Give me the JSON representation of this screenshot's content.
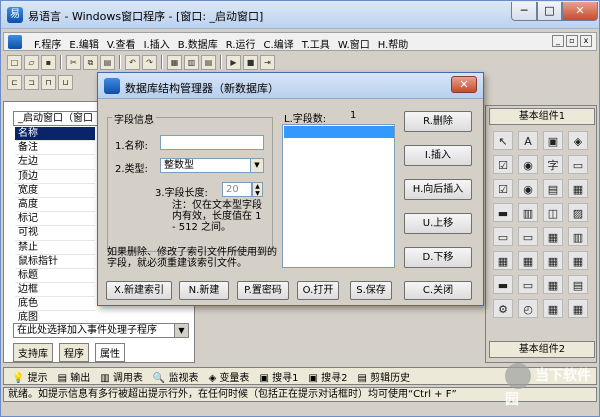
{
  "window": {
    "title": "易语言 - Windows窗口程序 - [窗口: _启动窗口]",
    "min": "─",
    "max": "□",
    "close": "✕"
  },
  "menu": [
    "F.程序",
    "E.编辑",
    "V.查看",
    "I.插入",
    "B.数据库",
    "R.运行",
    "C.编译",
    "T.工具",
    "W.窗口",
    "H.帮助"
  ],
  "left_panel": {
    "header": "_启动窗口（窗口",
    "properties": [
      "名称",
      "备注",
      "左边",
      "顶边",
      "宽度",
      "高度",
      "标记",
      "可视",
      "禁止",
      "鼠标指针",
      "标题",
      "边框",
      "底色",
      "底图"
    ],
    "event_select": "在此处选择加入事件处理子程序",
    "tabs": [
      "支持库",
      "程序",
      "属性"
    ]
  },
  "right_panel": {
    "header": "基本组件1",
    "footer": "基本组件2",
    "components": [
      "↖",
      "A",
      "▣",
      "◈",
      "☑",
      "◉",
      "字",
      "▭",
      "☑",
      "◉",
      "▤",
      "▦",
      "▬",
      "▥",
      "◫",
      "▨",
      "▭",
      "▭",
      "▦",
      "▥",
      "▦",
      "▦",
      "▦",
      "▦",
      "▬",
      "▭",
      "▦",
      "▤",
      "⚙",
      "◴",
      "▦",
      "▦"
    ]
  },
  "output_tabs": [
    "提示",
    "输出",
    "调用表",
    "监视表",
    "变量表",
    "搜寻1",
    "搜寻2",
    "剪辑历史"
  ],
  "status": "就绪。如提示信息有多行被超出提示行外，在任何时候（包括正在提示对话框时）均可使用“Ctrl + F”",
  "dialog": {
    "title": "数据库结构管理器（新数据库）",
    "close": "✕",
    "group_label": "字段信息",
    "name_label": "1.名称:",
    "type_label": "2.类型:",
    "type_value": "整数型",
    "length_label": "3.字段长度:",
    "length_value": "20",
    "note": "注：仅在文本型字段内有效，长度值在 1 - 512 之间。",
    "hint": "如果删除、修改了索引文件所使用到的字段，就必须重建该索引文件。",
    "field_count_label": "L.字段数:",
    "field_count_value": "1",
    "buttons_right": [
      "R.删除",
      "I.插入",
      "H.向后插入",
      "U.上移",
      "D.下移",
      "C.关闭"
    ],
    "buttons_bottom": [
      "X.新建索引",
      "N.新建",
      "P.置密码",
      "O.打开",
      "S.保存"
    ]
  },
  "watermark": "当下软件园"
}
